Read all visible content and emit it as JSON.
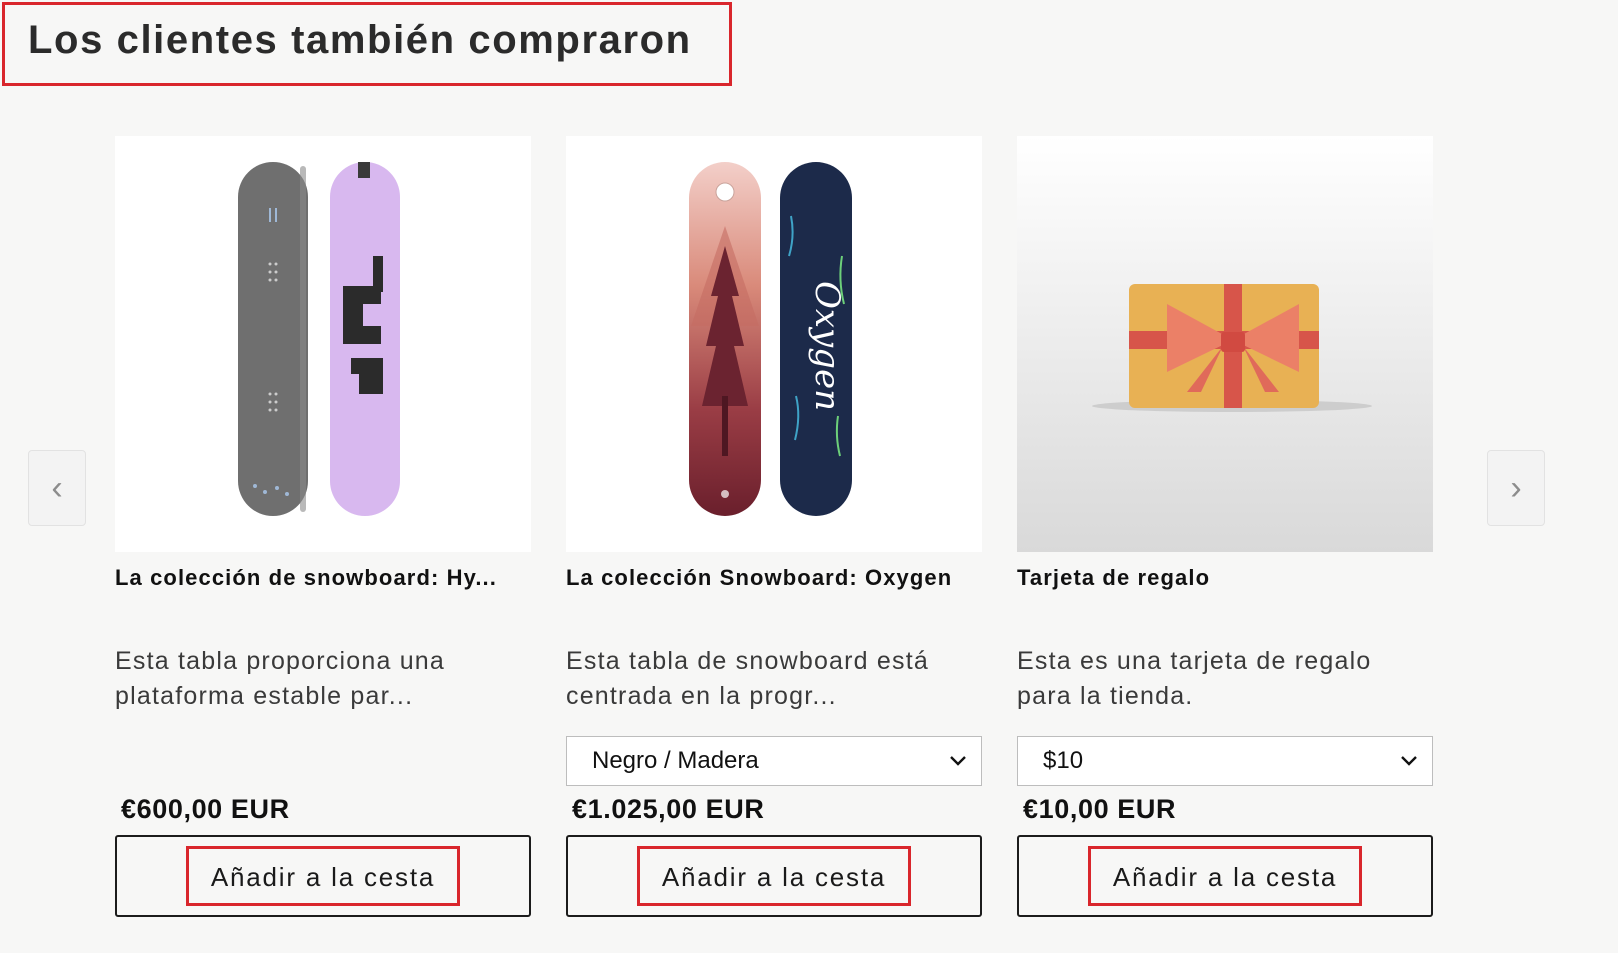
{
  "section": {
    "heading": "Los clientes también compraron"
  },
  "carousel": {
    "prev_glyph": "‹",
    "next_glyph": "›",
    "prev_icon": "chevron-left-icon",
    "next_icon": "chevron-right-icon"
  },
  "products": [
    {
      "title": "La colección de snowboard: Hy...",
      "description": "Esta tabla proporciona una plataforma estable par...",
      "variant": null,
      "price": "€600,00 EUR",
      "add_to_cart": "Añadir a la cesta"
    },
    {
      "title": "La colección Snowboard: Oxygen",
      "description": "Esta tabla de snowboard está centrada en la progr...",
      "variant": "Negro / Madera",
      "price": "€1.025,00 EUR",
      "add_to_cart": "Añadir a la cesta"
    },
    {
      "title": "Tarjeta de regalo",
      "description": "Esta es una tarjeta de regalo para la tienda.",
      "variant": "$10",
      "price": "€10,00 EUR",
      "add_to_cart": "Añadir a la cesta"
    }
  ],
  "colors": {
    "highlight": "#d9262c",
    "background": "#f7f7f6"
  }
}
